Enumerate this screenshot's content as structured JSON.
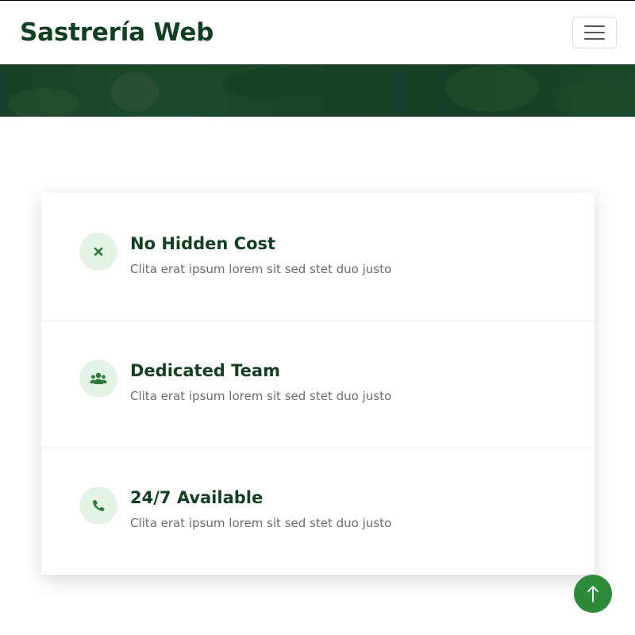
{
  "brand": {
    "name": "Sastrería Web"
  },
  "navbar": {
    "toggle_icon": "hamburger-menu-icon"
  },
  "features": [
    {
      "icon": "close-icon",
      "title": "No Hidden Cost",
      "description": "Clita erat ipsum lorem sit sed stet duo justo"
    },
    {
      "icon": "users-icon",
      "title": "Dedicated Team",
      "description": "Clita erat ipsum lorem sit sed stet duo justo"
    },
    {
      "icon": "phone-icon",
      "title": "24/7 Available",
      "description": "Clita erat ipsum lorem sit sed stet duo justo"
    }
  ],
  "back_to_top": {
    "icon": "arrow-up-icon"
  },
  "colors": {
    "brand_text": "#123f22",
    "accent": "#2d8a3a",
    "icon_bg": "#e5f3e7",
    "desc_text": "#6b6b6b"
  }
}
